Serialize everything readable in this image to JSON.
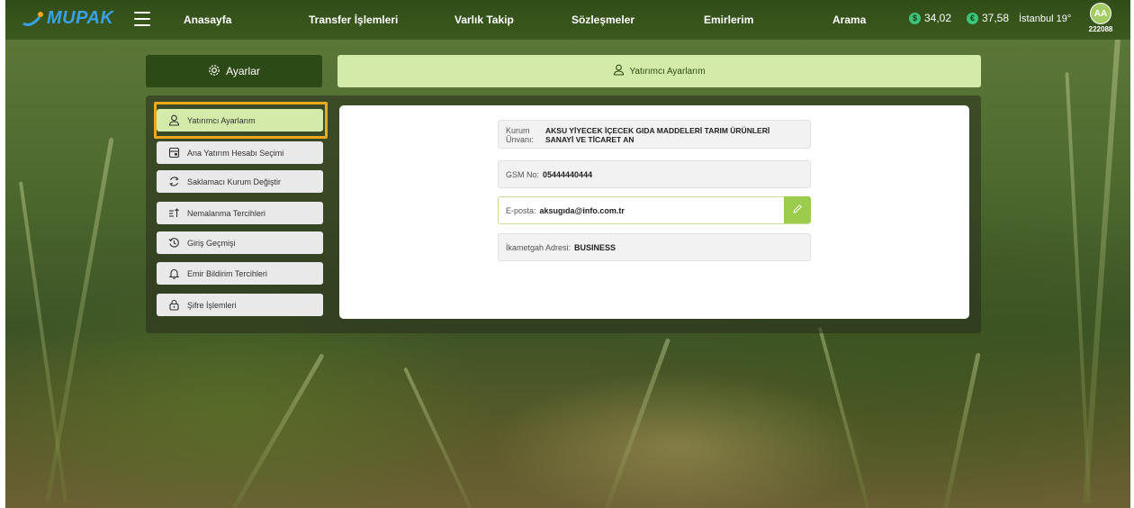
{
  "brand": {
    "name": "MUPAK"
  },
  "nav": {
    "items": [
      "Anasayfa",
      "Transfer İşlemleri",
      "Varlık Takip",
      "Sözleşmeler",
      "Emirlerim",
      "Arama"
    ]
  },
  "rates": {
    "usd": "34,02",
    "eur": "37,58",
    "usd_symbol": "$",
    "eur_symbol": "€"
  },
  "weather": "İstanbul 19°",
  "user": {
    "initials": "AA",
    "id": "222088"
  },
  "settings": {
    "label": "Ayarlar"
  },
  "page_title": "Yatırımcı Ayarlarım",
  "menu": [
    {
      "label": "Yatırımcı Ayarlarım",
      "icon": "user-icon",
      "active": true
    },
    {
      "label": "Ana Yatırım Hesabı Seçimi",
      "icon": "account-select-icon"
    },
    {
      "label": "Saklamacı Kurum Değiştir",
      "icon": "refresh-icon"
    },
    {
      "label": "Nemalanma Tercihleri",
      "icon": "sort-icon"
    },
    {
      "label": "Giriş Geçmişi",
      "icon": "history-icon"
    },
    {
      "label": "Emir Bildirim Tercihleri",
      "icon": "bell-icon"
    },
    {
      "label": "Şifre İşlemleri",
      "icon": "lock-icon"
    }
  ],
  "fields": {
    "institution": {
      "label_line1": "Kurum",
      "label_line2": "Ünvanı:",
      "value_line1": "AKSU YİYECEK İÇECEK GIDA MADDELERİ TARIM ÜRÜNLERİ",
      "value_line2": "SANAYİ VE TİCARET AN"
    },
    "gsm": {
      "label": "GSM No:",
      "value": "05444440444"
    },
    "email": {
      "label": "E-posta:",
      "value": "aksugıda@info.com.tr"
    },
    "address": {
      "label": "İkametgah Adresi:",
      "value": "BUSINESS"
    }
  },
  "colors": {
    "topbar": "#2f4d16",
    "accent": "#d4eaa9",
    "highlight": "#f2a81d",
    "edit": "#9ccc4c"
  }
}
